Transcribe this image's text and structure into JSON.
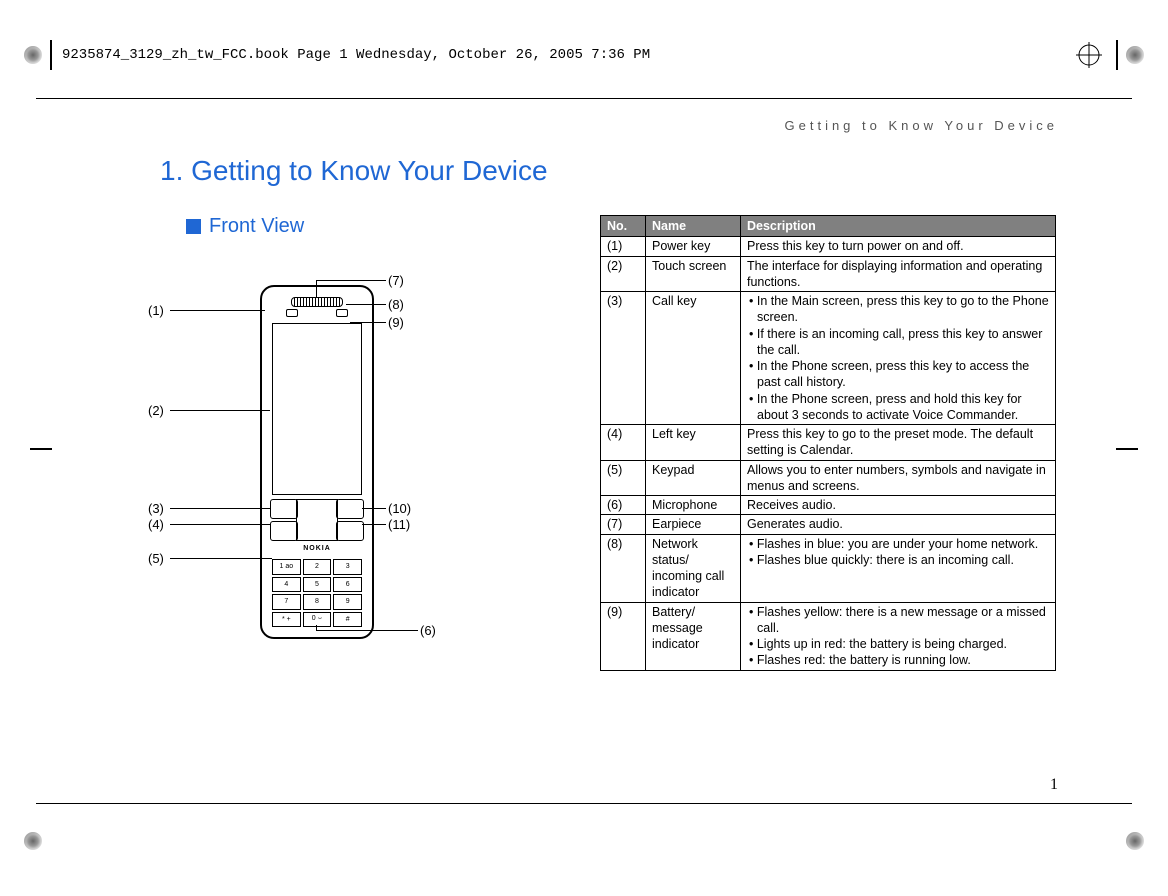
{
  "header_timestamp": "9235874_3129_zh_tw_FCC.book  Page 1  Wednesday, October 26, 2005  7:36 PM",
  "running_head": "Getting to Know Your Device",
  "chapter_title": "1.   Getting to Know Your Device",
  "section_title": "Front View",
  "brand_label": "NOKIA",
  "page_number": "1",
  "callouts": {
    "c1": "(1)",
    "c2": "(2)",
    "c3": "(3)",
    "c4": "(4)",
    "c5": "(5)",
    "c6": "(6)",
    "c7": "(7)",
    "c8": "(8)",
    "c9": "(9)",
    "c10": "(10)",
    "c11": "(11)"
  },
  "keypad": [
    "1 ao",
    "2",
    "3",
    "4",
    "5",
    "6",
    "7",
    "8",
    "9",
    "* +",
    "0 ⌣",
    "#"
  ],
  "table": {
    "headers": {
      "no": "No.",
      "name": "Name",
      "desc": "Description"
    },
    "rows": [
      {
        "no": "(1)",
        "name": "Power key",
        "desc": "Press this key to turn power on and off."
      },
      {
        "no": "(2)",
        "name": "Touch screen",
        "desc": "The interface for displaying information and operating functions."
      },
      {
        "no": "(3)",
        "name": "Call key",
        "desc": "• In the Main screen, press this key to go to the Phone screen.\n• If there is an incoming call, press this key to answer the call.\n• In the Phone screen, press this key to access the past call history.\n• In the Phone screen, press and hold this key for about 3 seconds to activate Voice Commander."
      },
      {
        "no": "(4)",
        "name": "Left key",
        "desc": "Press this key to go to the preset mode. The default setting is Calendar."
      },
      {
        "no": "(5)",
        "name": "Keypad",
        "desc": "Allows you to enter numbers, symbols and navigate in menus and screens."
      },
      {
        "no": "(6)",
        "name": "Microphone",
        "desc": "Receives audio."
      },
      {
        "no": "(7)",
        "name": "Earpiece",
        "desc": "Generates audio."
      },
      {
        "no": "(8)",
        "name": "Network status/\nincoming call indicator",
        "desc": "• Flashes in blue: you are under your home network.\n• Flashes blue quickly: there is an incoming call."
      },
      {
        "no": "(9)",
        "name": "Battery/\nmessage indicator",
        "desc": "• Flashes yellow: there is a new message or a missed call.\n• Lights up in red: the battery is being charged.\n• Flashes red: the battery is running low."
      }
    ]
  }
}
